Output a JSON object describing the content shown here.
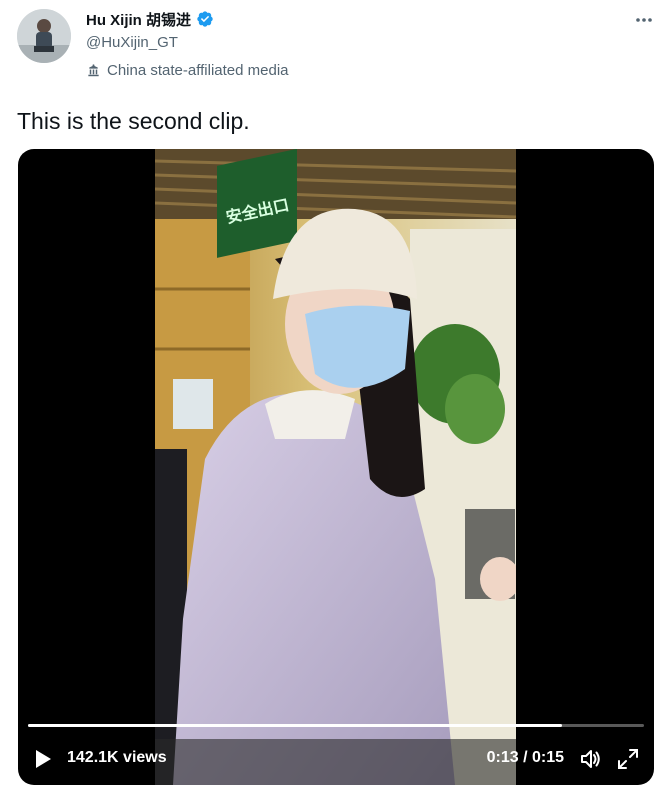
{
  "author": {
    "display_name": "Hu Xijin 胡锡进",
    "handle": "@HuXijin_GT",
    "label": "China state-affiliated media"
  },
  "tweet": {
    "text": "This is the second clip."
  },
  "video": {
    "views": "142.1K views",
    "elapsed": "0:13",
    "duration": "0:15",
    "time_display": "0:13 / 0:15",
    "progress_fraction": 0.867,
    "sign_text": "安全出口"
  },
  "colors": {
    "text_primary": "#0f1419",
    "text_secondary": "#536471",
    "verified_blue": "#1d9bf0",
    "video_bg": "#000000"
  },
  "icons": {
    "more": "more-dots-icon",
    "verified": "verified-badge-icon",
    "label": "state-media-icon",
    "play": "play-icon",
    "volume": "volume-icon",
    "fullscreen": "fullscreen-icon"
  }
}
